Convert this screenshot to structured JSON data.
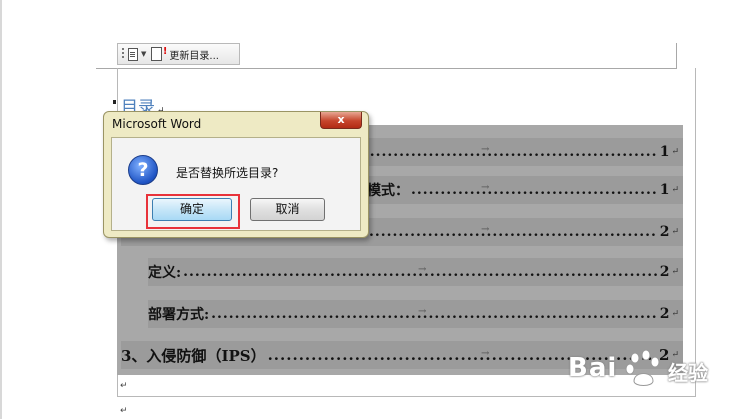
{
  "toolbar": {
    "update_label": "更新目录..."
  },
  "document": {
    "toc_title": "目录",
    "title_mark": "↵",
    "paragraph_mark": "↵",
    "tab_arrow": "→",
    "lines": [
      {
        "title": "",
        "page": "1"
      },
      {
        "title": "模式：",
        "page": "1"
      },
      {
        "title": "",
        "page": "2"
      },
      {
        "title": "定义:",
        "page": "2"
      },
      {
        "title": "部署方式:",
        "page": "2"
      },
      {
        "title": "3、入侵防御（IPS）",
        "page": "2"
      }
    ]
  },
  "dialog": {
    "title": "Microsoft Word",
    "close_label": "x",
    "icon_glyph": "?",
    "message": "是否替换所选目录?",
    "ok_label": "确定",
    "cancel_label": "取消"
  },
  "watermark": {
    "brand": "Bai",
    "sub": "经验"
  },
  "colors": {
    "selection": "#9b9b9b",
    "heading_blue": "#4f81bd",
    "highlight_red": "#e8323a",
    "dialog_frame": "#eeeac4"
  }
}
